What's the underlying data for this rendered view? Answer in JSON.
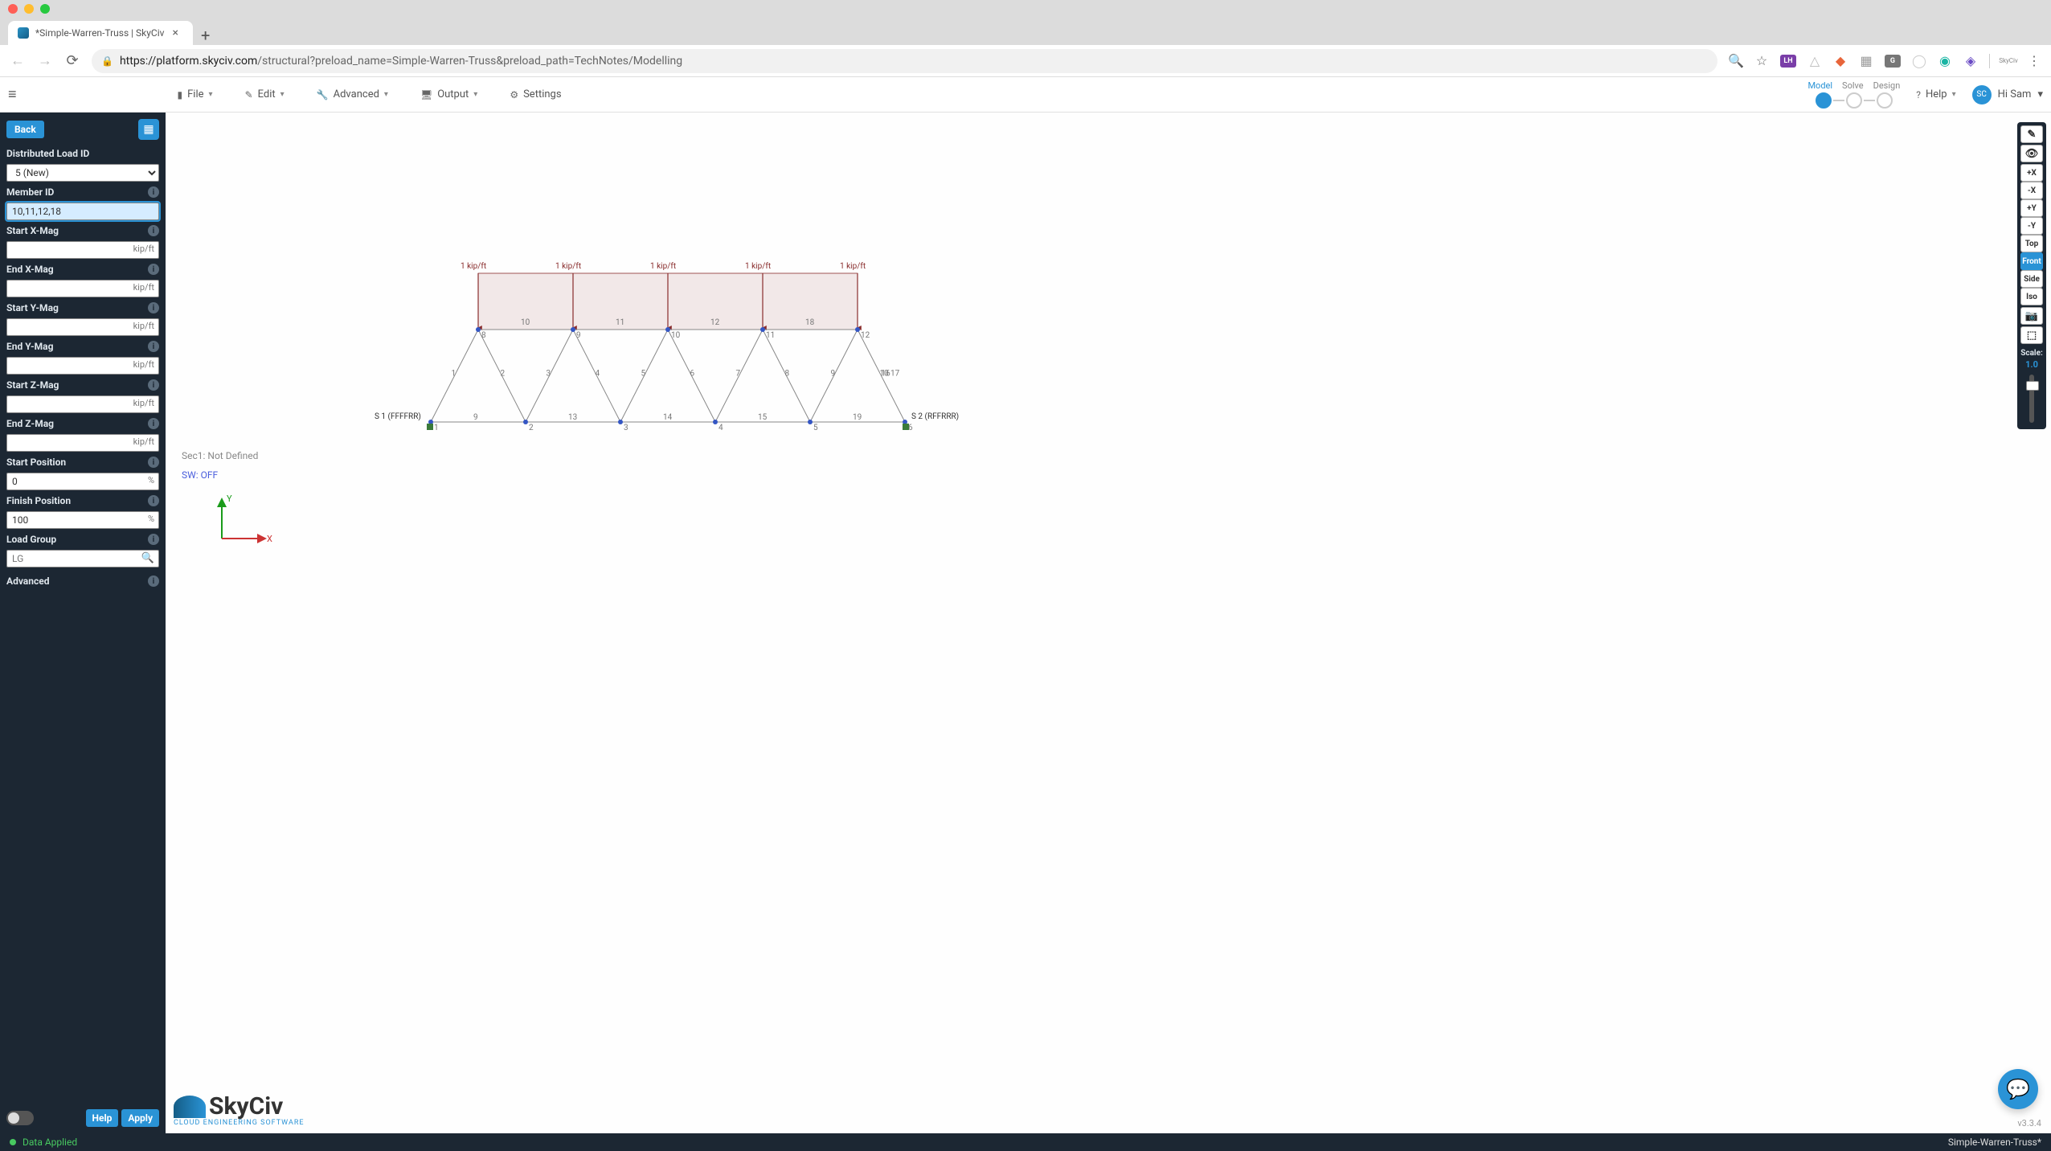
{
  "browser": {
    "tab_title": "*Simple-Warren-Truss | SkyCiv",
    "url_domain": "https://platform.skyciv.com",
    "url_path": "/structural?preload_name=Simple-Warren-Truss&preload_path=TechNotes/Modelling"
  },
  "toolbar": {
    "menus": {
      "file": "File",
      "edit": "Edit",
      "advanced": "Advanced",
      "output": "Output",
      "settings": "Settings"
    },
    "workflow": {
      "model": "Model",
      "solve": "Solve",
      "design": "Design"
    },
    "help": "Help",
    "user_initials": "SC",
    "greeting": "Hi Sam"
  },
  "sidebar": {
    "back": "Back",
    "labels": {
      "dl_id": "Distributed Load ID",
      "member_id": "Member ID",
      "sxm": "Start X-Mag",
      "exm": "End X-Mag",
      "sym": "Start Y-Mag",
      "eym": "End Y-Mag",
      "szm": "Start Z-Mag",
      "ezm": "End Z-Mag",
      "spos": "Start Position",
      "fpos": "Finish Position",
      "lg": "Load Group",
      "adv": "Advanced"
    },
    "dl_id_value": "5 (New)",
    "member_id_value": "10,11,12,18",
    "unit_force": "kip/ft",
    "unit_pct": "%",
    "spos_value": "0",
    "fpos_value": "100",
    "lg_placeholder": "LG",
    "help": "Help",
    "apply": "Apply"
  },
  "canvas": {
    "sec_note": "Sec1: Not Defined",
    "sw_note": "SW: OFF",
    "axis_x": "X",
    "axis_y": "Y",
    "logo_main": "SkyCiv",
    "logo_sub": "CLOUD ENGINEERING SOFTWARE",
    "version": "v3.3.4",
    "load_label": "1 kip/ft",
    "support_a": "S 1 (FFFFRR)",
    "support_b": "S 2 (RFFRRR)",
    "bottom_nodes": [
      "1",
      "2",
      "3",
      "4",
      "5",
      "6"
    ],
    "top_nodes": [
      "8",
      "9",
      "10",
      "11",
      "12"
    ],
    "diag_members": [
      "1",
      "2",
      "3",
      "4",
      "5",
      "6",
      "7",
      "8",
      "9",
      "10"
    ],
    "top_members": [
      "10",
      "11",
      "12",
      "18"
    ],
    "bottom_members": [
      "9",
      "13",
      "14",
      "15",
      "19"
    ],
    "edge_members": {
      "left": "16",
      "right": "17"
    }
  },
  "right_tools": {
    "buttons": [
      "+X",
      "-X",
      "+Y",
      "-Y",
      "Top",
      "Front",
      "Side",
      "Iso"
    ],
    "active": "Front",
    "scale_label": "Scale:",
    "scale_value": "1.0"
  },
  "status": {
    "left": "Data Applied",
    "right": "Simple-Warren-Truss*"
  }
}
